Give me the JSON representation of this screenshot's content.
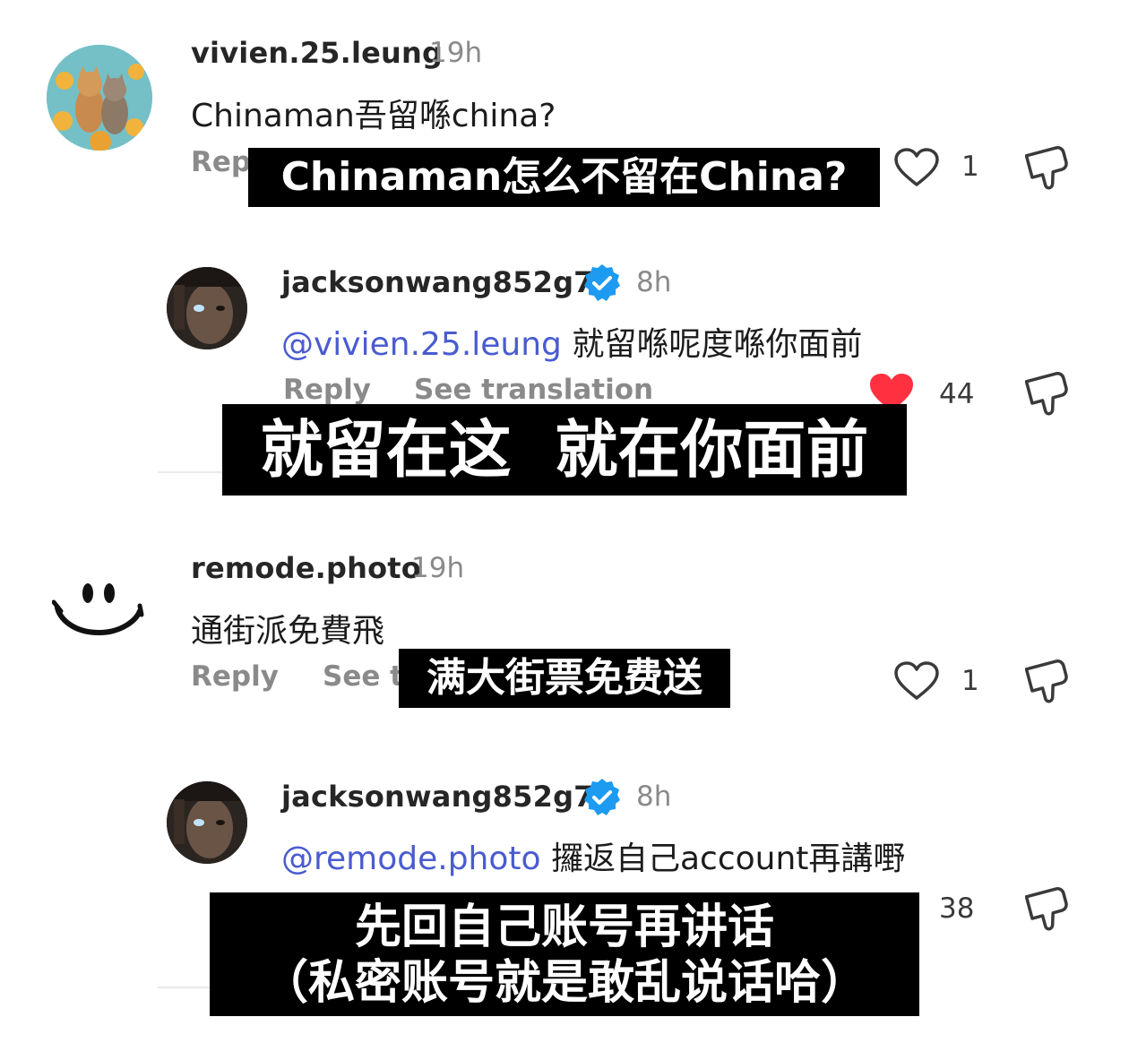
{
  "comments": [
    {
      "username": "vivien.25.leung",
      "time": "19h",
      "text": "Chinaman吾留喺china?",
      "reply_label": "Rep",
      "like_count": "1",
      "subtitle": "Chinaman怎么不留在China?"
    },
    {
      "username": "jacksonwang852g7",
      "time": "8h",
      "mention": "@vivien.25.leung",
      "text": " 就留喺呢度喺你面前",
      "reply_label": "Reply",
      "translation_label": "See translation",
      "like_count": "44",
      "subtitle": "就留在这  就在你面前"
    },
    {
      "username": "remode.photo",
      "time": "19h",
      "text": "通街派免費飛",
      "reply_label": "Reply",
      "translation_label": "See t",
      "like_count": "1",
      "subtitle": "满大街票免费送"
    },
    {
      "username": "jacksonwang852g7",
      "time": "8h",
      "mention": "@remode.photo",
      "text": " 攞返自己account再講嘢",
      "like_count": "38",
      "subtitle_line1": "先回自己账号再讲话",
      "subtitle_line2": "（私密账号就是敢乱说话哈）"
    }
  ],
  "icons": {
    "like": "heart-outline-icon",
    "liked": "heart-filled-icon",
    "verified": "verified-badge-icon",
    "dislike": "dislike-icon"
  },
  "colors": {
    "liked_red": "#ff3040",
    "verified_blue": "#1d9bf0",
    "mention_blue": "#4a5bd0"
  }
}
